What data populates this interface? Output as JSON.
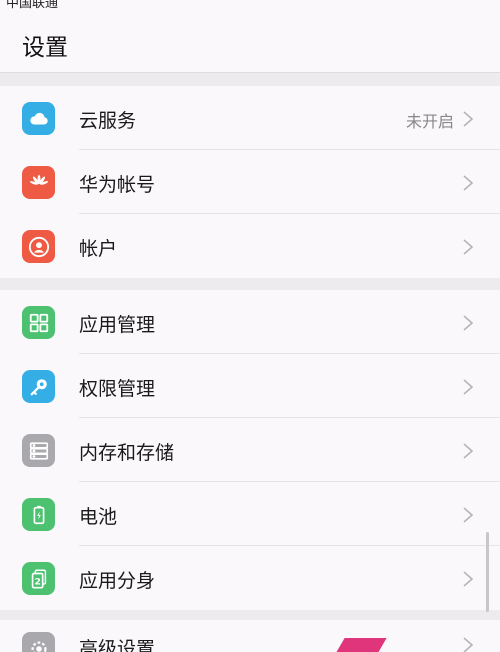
{
  "status_bar": {
    "carrier": "中国联通"
  },
  "header": {
    "title": "设置"
  },
  "colors": {
    "cloud": "#35aee6",
    "huawei": "#ee5a43",
    "account": "#ee5a43",
    "apps": "#4cc170",
    "permission": "#35aee6",
    "storage": "#a9a8ac",
    "battery": "#4cc170",
    "twin": "#4cc170",
    "advanced": "#a9a8ac"
  },
  "groups": [
    {
      "items": [
        {
          "id": "cloud",
          "label": "云服务",
          "value": "未开启",
          "icon": "cloud-icon"
        },
        {
          "id": "huawei-id",
          "label": "华为帐号",
          "value": "",
          "icon": "huawei-logo-icon"
        },
        {
          "id": "account",
          "label": "帐户",
          "value": "",
          "icon": "user-icon"
        }
      ]
    },
    {
      "items": [
        {
          "id": "app-manage",
          "label": "应用管理",
          "value": "",
          "icon": "grid-icon"
        },
        {
          "id": "permission",
          "label": "权限管理",
          "value": "",
          "icon": "key-icon"
        },
        {
          "id": "storage",
          "label": "内存和存储",
          "value": "",
          "icon": "storage-icon"
        },
        {
          "id": "battery",
          "label": "电池",
          "value": "",
          "icon": "battery-icon"
        },
        {
          "id": "app-twin",
          "label": "应用分身",
          "value": "",
          "icon": "app-twin-icon"
        }
      ]
    },
    {
      "items": [
        {
          "id": "advanced",
          "label": "高级设置",
          "value": "",
          "icon": "gear-icon"
        }
      ]
    }
  ]
}
